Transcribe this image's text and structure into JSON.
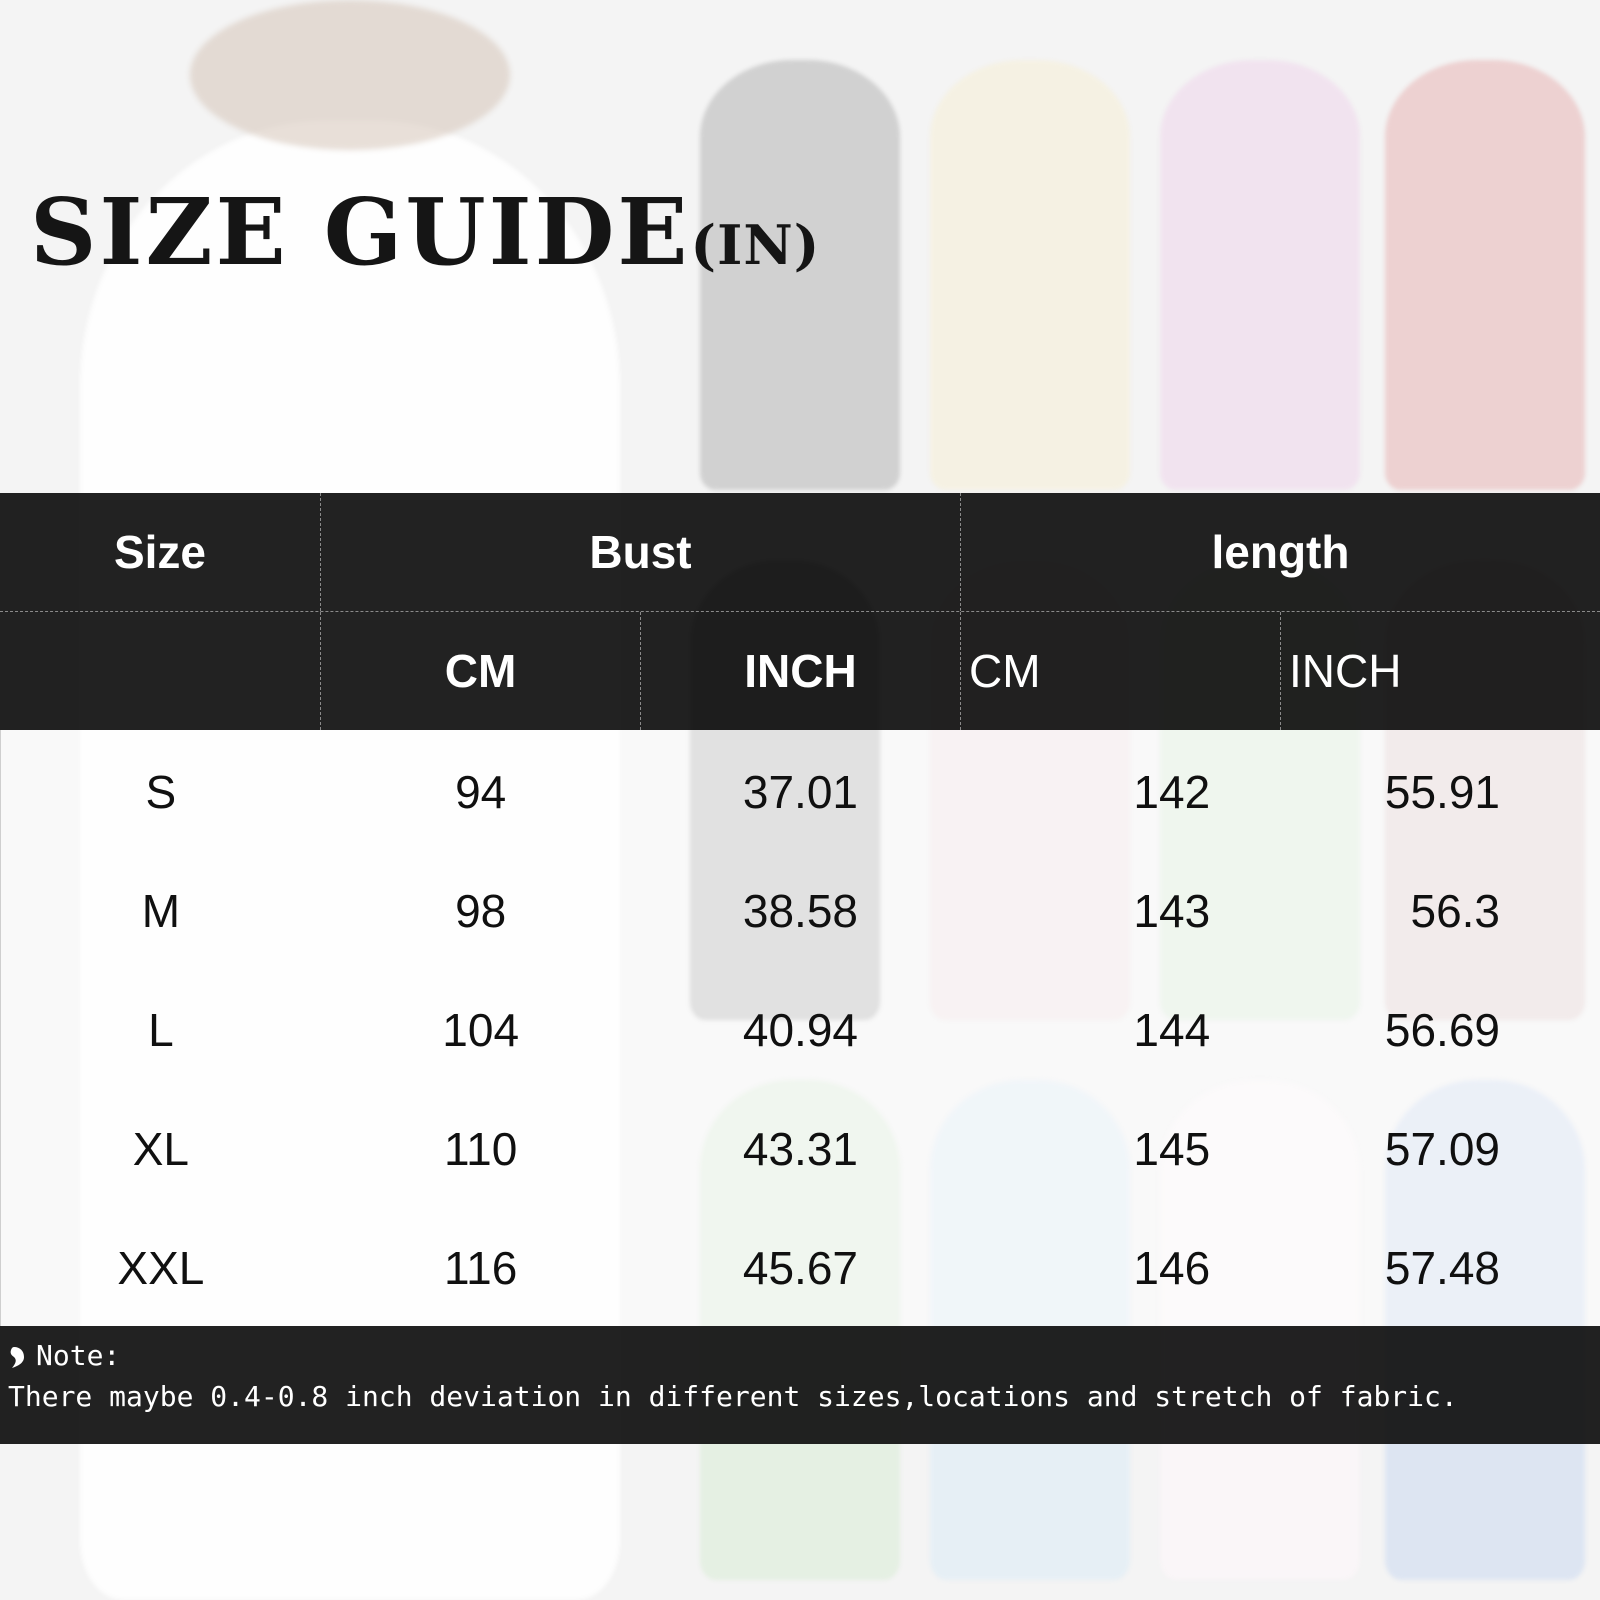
{
  "title": {
    "main": "SIZE GUIDE",
    "unit": "(IN)"
  },
  "table": {
    "header_top": {
      "size": "Size",
      "bust": "Bust",
      "length": "length"
    },
    "header_sub": {
      "bust_cm": "CM",
      "bust_inch": "INCH",
      "length_cm": "CM",
      "length_inch": "INCH"
    },
    "rows": [
      {
        "size": "S",
        "bust_cm": "94",
        "bust_inch": "37.01",
        "length_cm": "142",
        "length_inch": "55.91"
      },
      {
        "size": "M",
        "bust_cm": "98",
        "bust_inch": "38.58",
        "length_cm": "143",
        "length_inch": "56.3"
      },
      {
        "size": "L",
        "bust_cm": "104",
        "bust_inch": "40.94",
        "length_cm": "144",
        "length_inch": "56.69"
      },
      {
        "size": "XL",
        "bust_cm": "110",
        "bust_inch": "43.31",
        "length_cm": "145",
        "length_inch": "57.09"
      },
      {
        "size": "XXL",
        "bust_cm": "116",
        "bust_inch": "45.67",
        "length_cm": "146",
        "length_inch": "57.48"
      }
    ]
  },
  "note": {
    "label": "Note:",
    "text": "There maybe 0.4-0.8 inch deviation in different sizes,locations and stretch of fabric."
  },
  "colors": {
    "header_bg": "#0a0a0a",
    "dress_black": "#3a3a3a",
    "dress_cream": "#f3efe0",
    "dress_pink": "#efe3ee",
    "dress_red": "#e6b7b7",
    "dress_green": "#dfeedd",
    "dress_white": "#fafcfd",
    "dress_blue": "#d7e0f0"
  }
}
